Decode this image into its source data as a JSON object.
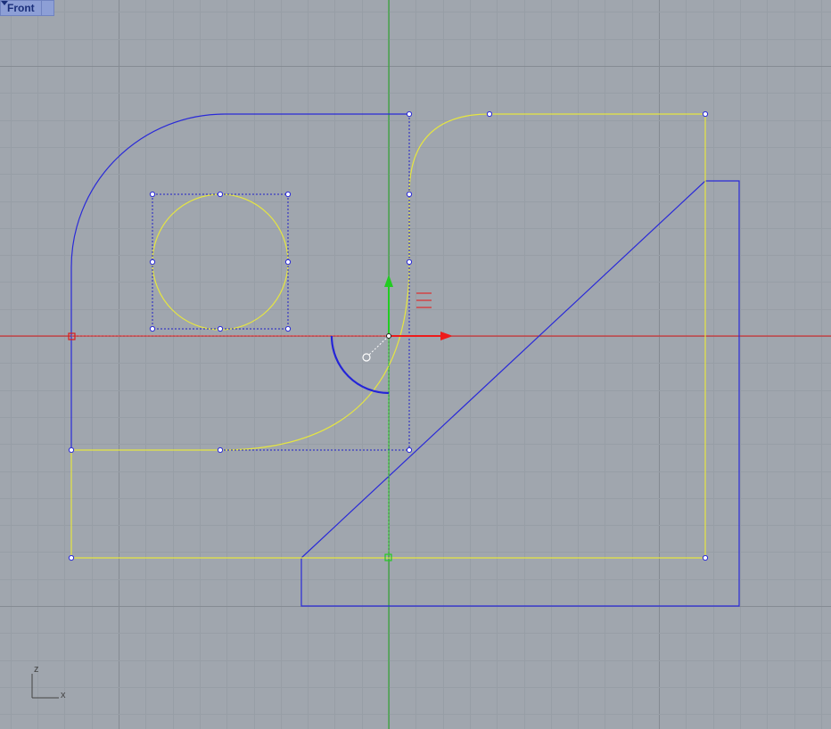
{
  "viewport": {
    "name": "Front",
    "background": "#a0a6ae",
    "axes_icon": {
      "vertical": "z",
      "horizontal": "x"
    },
    "icons": {
      "menu": "chevron-down-icon",
      "gumball": "gumball-icon",
      "axes": "world-axes-icon"
    }
  },
  "colors": {
    "grid_minor": "#979ea6",
    "grid_major": "#858b93",
    "x_axis": "#dd1c1c",
    "z_axis": "#22aa22",
    "curve": "#2a2ad8",
    "selected_curve": "#e6e640",
    "control_polygon": "#2020c8"
  }
}
